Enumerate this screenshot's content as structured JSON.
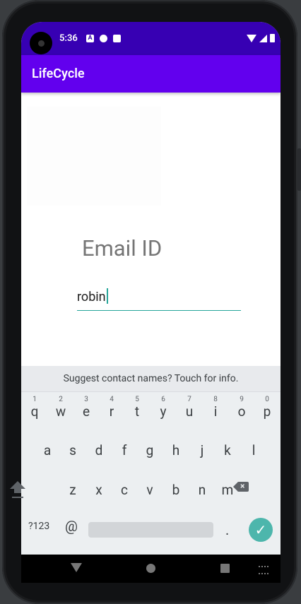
{
  "status_bar": {
    "time": "5:36",
    "notification_icons": [
      "a-icon",
      "circle-half-icon",
      "sim-icon"
    ],
    "system_icons": [
      "wifi-icon",
      "signal-icon",
      "battery-icon"
    ]
  },
  "app_bar": {
    "title": "LifeCycle"
  },
  "form": {
    "email_label": "Email ID",
    "email_value": "robin"
  },
  "keyboard": {
    "suggestion": "Suggest contact names? Touch for info.",
    "row1": [
      {
        "key": "q",
        "hint": "1"
      },
      {
        "key": "w",
        "hint": "2"
      },
      {
        "key": "e",
        "hint": "3"
      },
      {
        "key": "r",
        "hint": "4"
      },
      {
        "key": "t",
        "hint": "5"
      },
      {
        "key": "y",
        "hint": "6"
      },
      {
        "key": "u",
        "hint": "7"
      },
      {
        "key": "i",
        "hint": "8"
      },
      {
        "key": "o",
        "hint": "9"
      },
      {
        "key": "p",
        "hint": "0"
      }
    ],
    "row2": [
      "a",
      "s",
      "d",
      "f",
      "g",
      "h",
      "j",
      "k",
      "l"
    ],
    "row3": [
      "z",
      "x",
      "c",
      "v",
      "b",
      "n",
      "m"
    ],
    "symbols_key": "?123",
    "at_key": "@",
    "period_key": ".",
    "enter_icon": "checkmark-icon",
    "accent": "#4db6ac"
  },
  "navigation": {
    "icons": [
      "back-icon",
      "home-icon",
      "recents-icon",
      "keyboard-switch-icon"
    ]
  },
  "colors": {
    "status_bar": "#3700b3",
    "app_bar": "#6200ee",
    "input_underline": "#26a69a"
  }
}
